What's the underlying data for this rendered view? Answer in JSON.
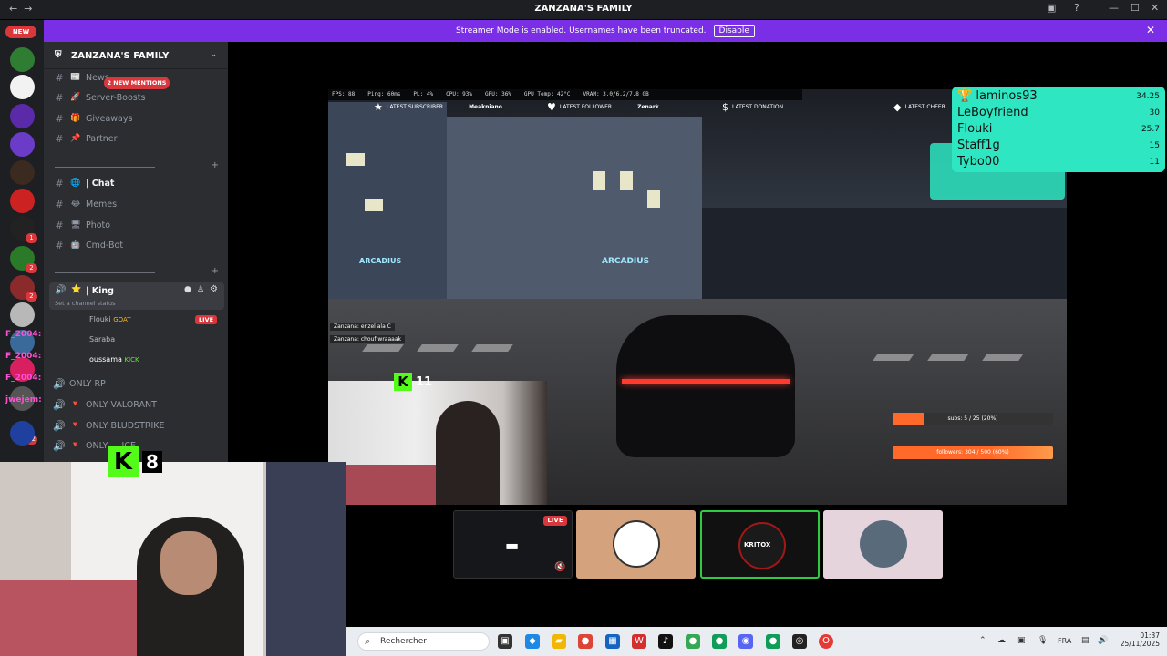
{
  "window": {
    "title": "ZANZANA'S FAMILY",
    "nav_back": "←",
    "nav_fwd": "→"
  },
  "banner": {
    "text": "Streamer Mode is enabled. Usernames have been truncated.",
    "button": "Disable",
    "close": "✕"
  },
  "rail": {
    "new_label": "NEW",
    "counts": [
      "1",
      "2",
      "2",
      "22"
    ]
  },
  "server": {
    "name": "ZANZANA'S FAMILY",
    "mentions": "2 NEW MENTIONS"
  },
  "channels": [
    {
      "label": "News",
      "emoji": "📰"
    },
    {
      "label": "Server-Boosts",
      "emoji": "🚀"
    },
    {
      "label": "Giveaways",
      "emoji": "🎁"
    },
    {
      "label": "Partner",
      "emoji": "📌"
    }
  ],
  "channels2": [
    {
      "label": "| Chat",
      "emoji": "🌐"
    },
    {
      "label": "Memes",
      "emoji": "😂"
    },
    {
      "label": "Photo",
      "emoji": "🖥"
    },
    {
      "label": "Cmd-Bot",
      "emoji": "🤖"
    }
  ],
  "voice": {
    "channel": "| King",
    "status": "Set a channel status",
    "live": "LIVE",
    "users": [
      {
        "name": "Flouki",
        "tag": "GOAT"
      },
      {
        "name": "Saraba",
        "tag": ""
      },
      {
        "name": "oussama",
        "tag": "KICK"
      }
    ]
  },
  "voice_channels": [
    "ONLY RP",
    "ONLY VALORANT",
    "ONLY BLUDSTRIKE",
    "ONLY ... ICE"
  ],
  "overlay_names": [
    "F_2004:",
    "F_2004:",
    "F_2004:",
    "jwejem:"
  ],
  "stream": {
    "stats": [
      "FPS: 88",
      "Ping: 60ms",
      "PL: 4%",
      "CPU: 93%",
      "GPU: 36%",
      "GPU Temp: 42°C",
      "VRAM: 3.0/6.2/7.8 GB"
    ],
    "alerts": [
      {
        "icon": "★",
        "label": "LATEST SUBSCRIBER",
        "value": "Meakniano"
      },
      {
        "icon": "♥",
        "label": "LATEST FOLLOWER",
        "value": "Zenark"
      },
      {
        "icon": "$",
        "label": "LATEST DONATION",
        "value": ""
      },
      {
        "icon": "◆",
        "label": "LATEST CHEER",
        "value": ""
      }
    ],
    "chat": [
      "Zanzana: enzel ala C",
      "Zanzana: chouf wraaaak"
    ],
    "signs": [
      "ARCADIUS",
      "ARCADIUS"
    ],
    "goal_subs": "subs: 5 / 25 (20%)",
    "goal_followers": "followers: 304 / 500 (60%)",
    "kick_viewers": "11"
  },
  "leaderboard": [
    {
      "name": "laminos93",
      "score": "34.25"
    },
    {
      "name": "LeBoyfriend",
      "score": "30"
    },
    {
      "name": "Flouki",
      "score": "25.7"
    },
    {
      "name": "Staff1g",
      "score": "15"
    },
    {
      "name": "Tybo00",
      "score": "11"
    }
  ],
  "cam": {
    "kick_viewers": "8"
  },
  "participants": {
    "live": "LIVE",
    "tile3_text": "KRITOX"
  },
  "taskbar": {
    "search": "Rechercher",
    "lang": "FRA",
    "time": "01:37",
    "date": "25/11/2025"
  },
  "colors": {
    "accent": "#7a2ee6",
    "kick": "#53fc18",
    "leaderboard": "#2ee6c2",
    "danger": "#da373c"
  }
}
